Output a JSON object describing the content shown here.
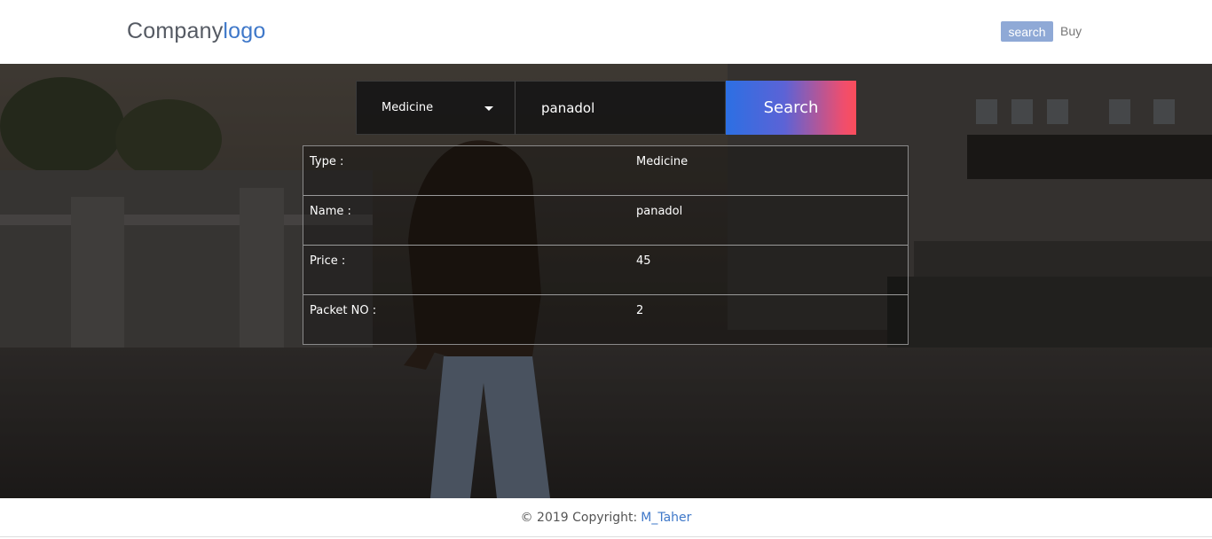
{
  "header": {
    "logo_main": "Company",
    "logo_accent": "logo",
    "nav_search": "search",
    "nav_buy": "Buy"
  },
  "search": {
    "type_selected": "Medicine",
    "query_value": "panadol",
    "button_label": "Search"
  },
  "results": {
    "rows": [
      {
        "label": "Type :",
        "value": "Medicine"
      },
      {
        "label": "Name :",
        "value": "panadol"
      },
      {
        "label": "Price :",
        "value": "45"
      },
      {
        "label": "Packet NO :",
        "value": "2"
      }
    ]
  },
  "footer": {
    "copyright": "© 2019 Copyright:",
    "author": "M_Taher"
  },
  "colors": {
    "brand_blue": "#3f78c9",
    "nav_badge": "#8fa9d6",
    "gradient_start": "#2c6fe3",
    "gradient_end": "#fb4d5b"
  }
}
